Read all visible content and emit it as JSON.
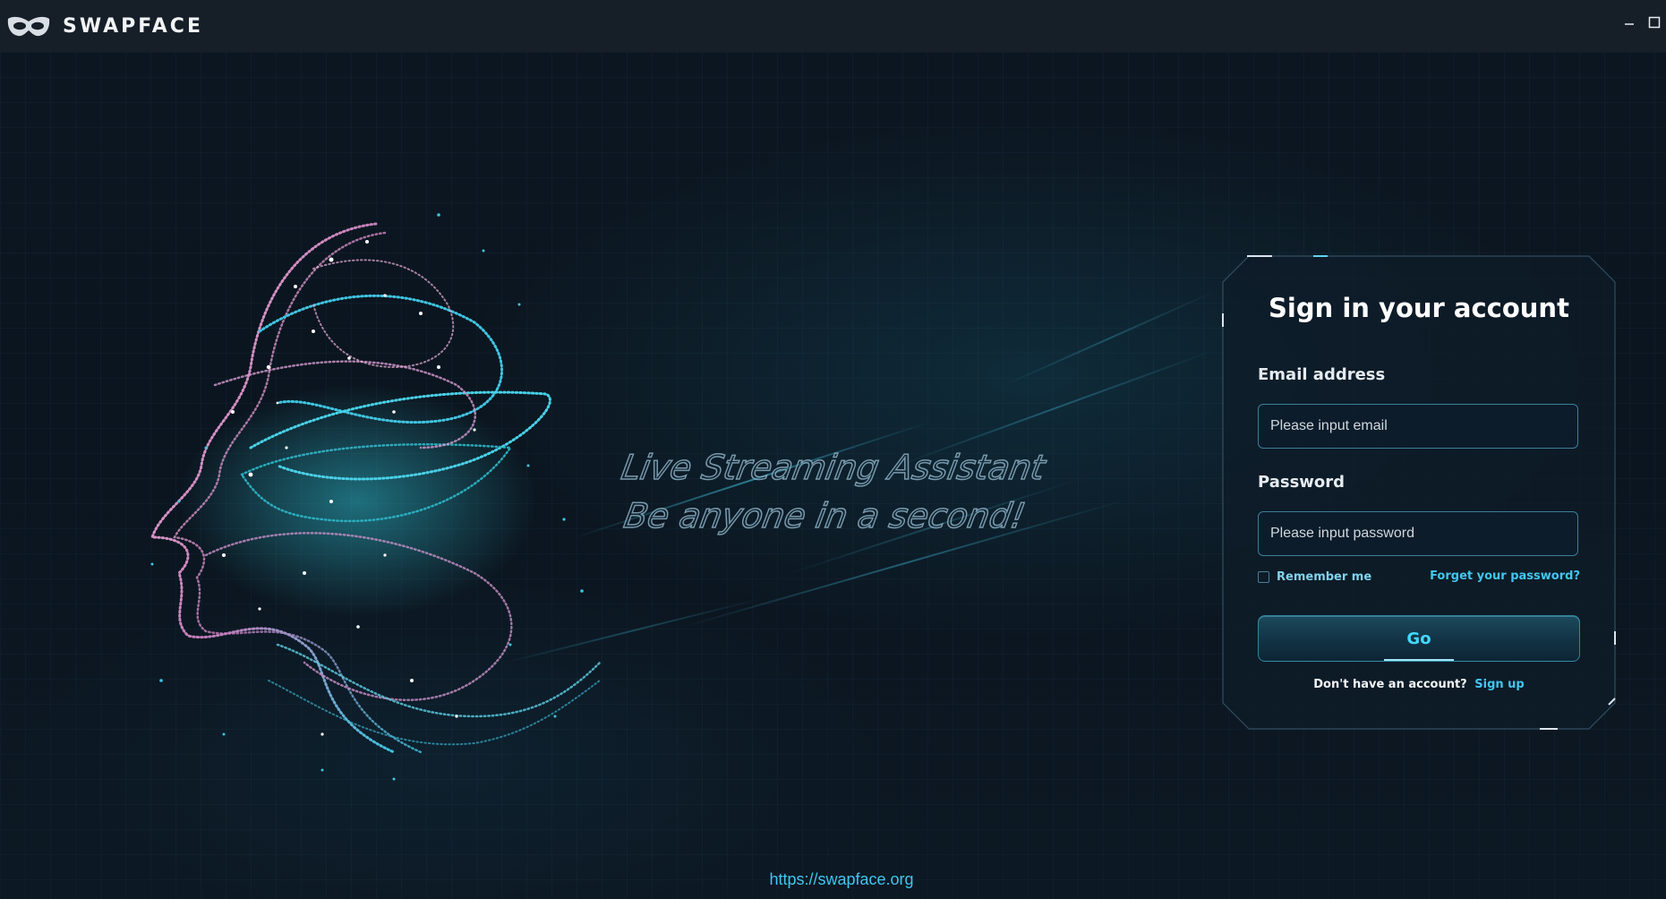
{
  "titlebar": {
    "brand": "SWAPFACE",
    "logo_icon": "mask-icon",
    "minimize_icon": "minimize-icon",
    "maximize_icon": "maximize-icon"
  },
  "hero": {
    "tagline_line1": "Live Streaming Assistant",
    "tagline_line2": "Be anyone in a second!"
  },
  "login": {
    "title": "Sign in your account",
    "email_label": "Email address",
    "email_placeholder": "Please input email",
    "email_value": "",
    "password_label": "Password",
    "password_placeholder": "Please input password",
    "password_value": "",
    "remember_label": "Remember me",
    "remember_checked": false,
    "forgot_label": "Forget your password?",
    "submit_label": "Go",
    "signup_prompt": "Don't have an account?",
    "signup_link": "Sign up"
  },
  "footer": {
    "url": "https://swapface.org"
  },
  "colors": {
    "accent": "#41c6ee",
    "background": "#0b141d",
    "titlebar": "#161e28",
    "input_border": "#3d7f98"
  }
}
